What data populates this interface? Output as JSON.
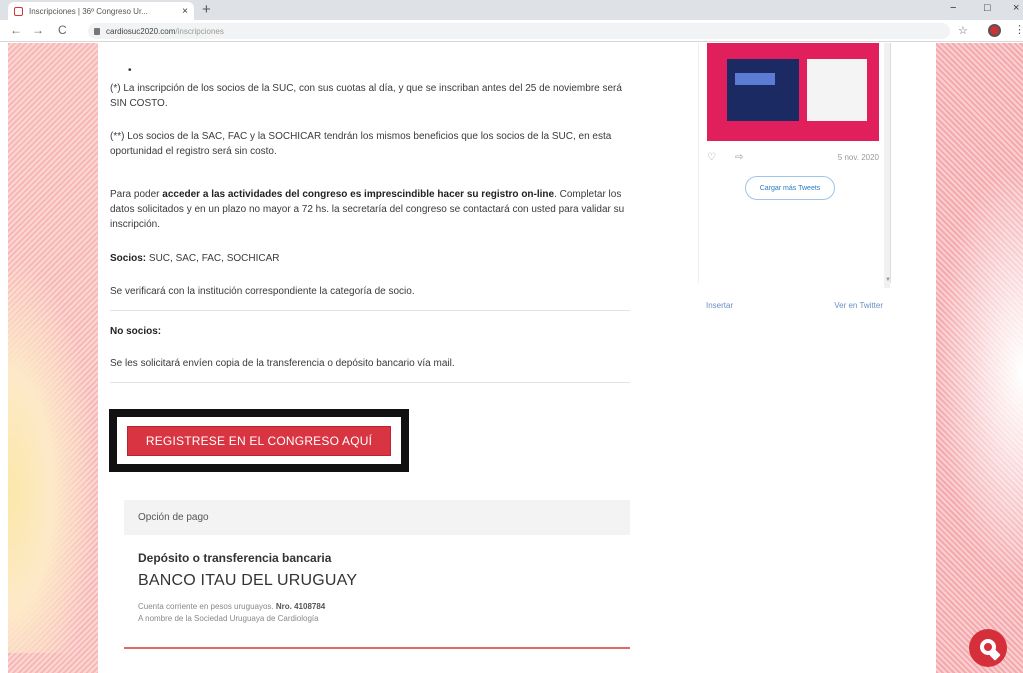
{
  "browser": {
    "tab_title": "Inscripciones | 36º Congreso Ur...",
    "tab_close": "×",
    "new_tab": "+",
    "url_host": "cardiosuc2020.com",
    "url_path": "/inscripciones",
    "minimize": "−",
    "maximize": "□",
    "close": "×",
    "back": "←",
    "forward": "→",
    "reload": "C",
    "bookmark": "☆",
    "menu": "⋮"
  },
  "content": {
    "bullet": "•",
    "p1_bold": "(*) La inscripción de los socios de la SUC, con sus cuotas al día, y que se inscriban antes del 25 de noviembre será SIN COSTO.",
    "p2": "(**) Los socios de la SAC, FAC y la SOCHICAR tendrán los mismos beneficios que los socios de la SUC, en esta oportunidad el registro será sin costo.",
    "p3_a": "Para poder ",
    "p3_b": "acceder a las actividades del congreso es imprescindible hacer su registro on-line",
    "p3_c": ". Completar los datos solicitados y en un plazo no mayor a 72 hs. la secretaría del congreso se contactará con usted para validar su inscripción.",
    "socios_label": "Socios:",
    "socios_value": " SUC, SAC, FAC, SOCHICAR",
    "p5": "Se verificará con la institución correspondiente la categoría de socio.",
    "no_socios_label": "No socios:",
    "p7": "Se les solicitará envíen copia de la transferencia o depósito bancario vía mail."
  },
  "register_button": "REGISTRESE EN EL CONGRESO AQUÍ",
  "payment": {
    "header": "Opción de pago",
    "method": "Depósito o transferencia bancaria",
    "bank": "BANCO ITAU DEL URUGUAY",
    "account_prefix": "Cuenta corriente en pesos uruguayos. ",
    "account_number": "Nro. 4108784",
    "account_holder": "A nombre de la Sociedad Uruguaya de Cardiología"
  },
  "twitter": {
    "date": "5 nov. 2020",
    "load_more": "Cargar más Tweets",
    "embed": "Insertar",
    "view_on_twitter": "Ver en Twitter",
    "heart": "♡",
    "share": "⇨"
  },
  "colors": {
    "accent_red": "#d93442",
    "frame_black": "#111111",
    "link_blue": "#2a7bc6"
  }
}
